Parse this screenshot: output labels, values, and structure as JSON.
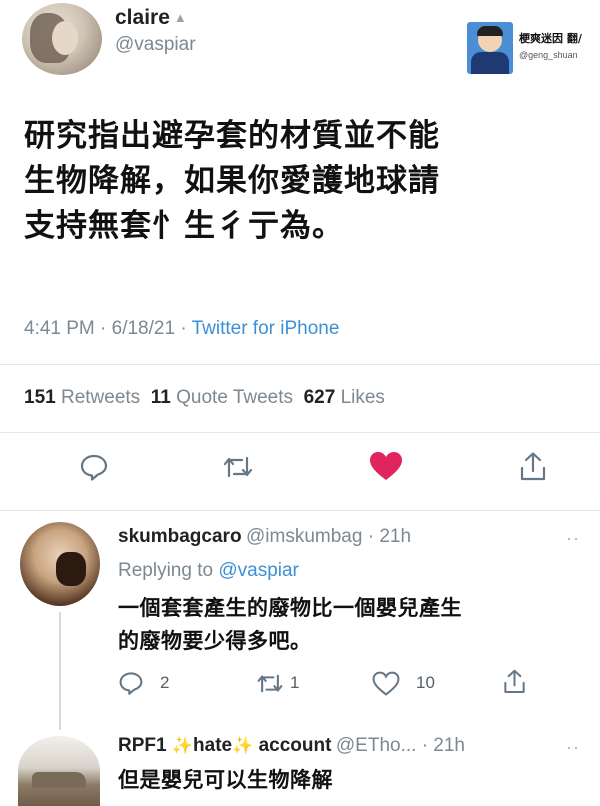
{
  "main_tweet": {
    "name": "claire",
    "lock_icon": "lock-icon",
    "handle": "@vaspiar",
    "text_lines": [
      "研究指出避孕套的材質並不能",
      "生物降解，如果你愛護地球請",
      "支持無套忄生彳亍為。"
    ],
    "time": "4:41 PM · 6/18/21 · ",
    "source": "Twitter for iPhone",
    "retweets_count": "151",
    "retweets_label": "Retweets",
    "quotes_count": "11",
    "quotes_label": "Quote Tweets",
    "likes_count": "627",
    "likes_label": "Likes"
  },
  "watermark": {
    "title": "梗爽迷因 翻/",
    "handle": "@geng_shuan"
  },
  "replies": [
    {
      "name": "skumbagcaro",
      "handle": "@imskumbag · 21h",
      "replying_label": "Replying to ",
      "replying_to": "@vaspiar",
      "text_lines": [
        "一個套套產生的廢物比一個嬰兒產生",
        "的廢物要少得多吧。"
      ],
      "reply_count": "2",
      "retweet_count": "1",
      "like_count": "10"
    },
    {
      "name_part1": "RPF1",
      "sparkle": "✨",
      "name_part2": "hate",
      "name_part3": "account",
      "handle": "@ETho... · 21h",
      "text": "但是嬰兒可以生物降解"
    }
  ],
  "colors": {
    "like_heart": "#e0245e",
    "link_blue": "#3d8fd6",
    "muted": "#7d8891"
  }
}
